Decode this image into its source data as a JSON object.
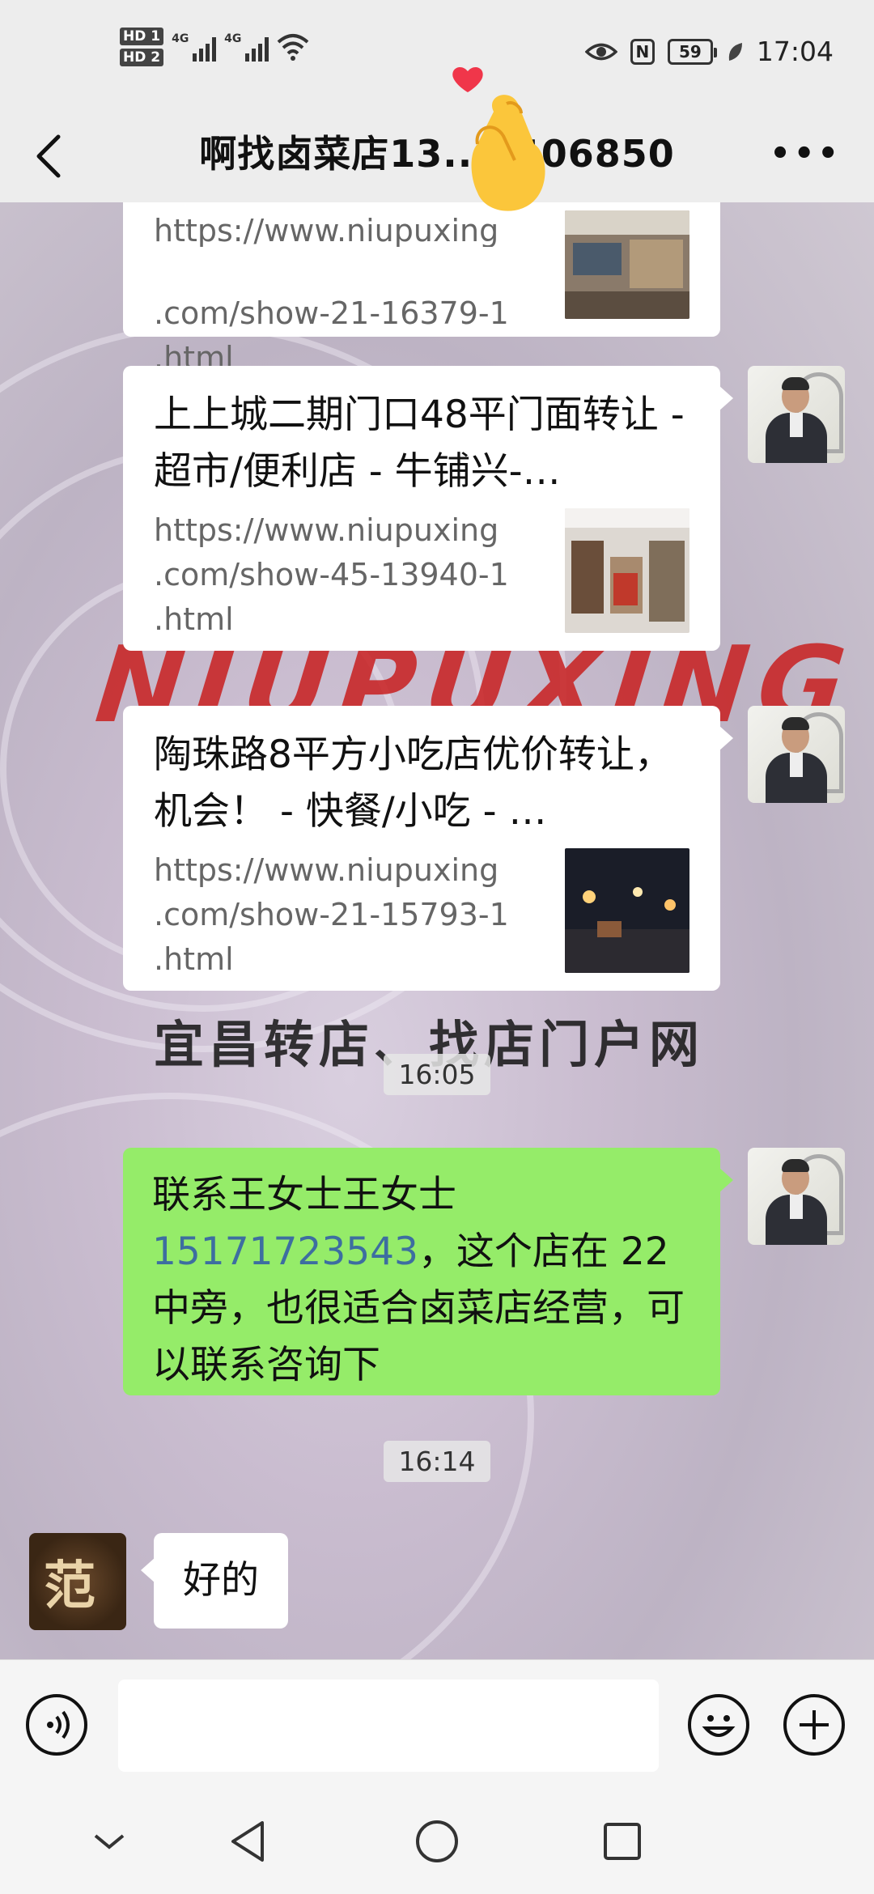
{
  "status_bar": {
    "sim1": "HD 1",
    "sim2": "HD 2",
    "net1": "4G",
    "net2": "4G",
    "battery": "59",
    "time": "17:04"
  },
  "header": {
    "title": "啊找卤菜店13...3406850"
  },
  "messages": [
    {
      "url": ".com/show-21-16379-1\n.html",
      "url_partial_top": "https://www.niupuxing"
    },
    {
      "title": "上上城二期门口48平门面转让 - 超市/便利店 - 牛铺兴-…",
      "url": "https://www.niupuxing\n.com/show-45-13940-1\n.html"
    },
    {
      "title": "陶珠路8平方小吃店优价转让，机会！ - 快餐/小吃 - …",
      "url": "https://www.niupuxing\n.com/show-21-15793-1\n.html"
    }
  ],
  "time_1": "16:05",
  "green_message": {
    "prefix": "联系王女士王女士",
    "phone": "15171723543",
    "suffix": "，这个店在 22 中旁，也很适合卤菜店经营，可以联系咨询下"
  },
  "time_2": "16:14",
  "reply": {
    "text": "好的",
    "avatar_char": "范"
  },
  "watermark": {
    "brand": "NIUPUXING",
    "slogan": "宜昌转店、找店门户网"
  },
  "input": {
    "placeholder": ""
  },
  "colors": {
    "green_bubble": "#95ec69",
    "phone_link": "#3d6ea0",
    "background": "#ededed"
  }
}
